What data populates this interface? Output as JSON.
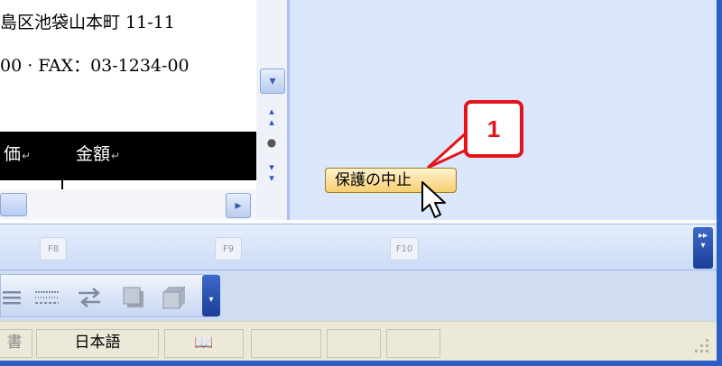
{
  "document": {
    "address_line": "島区池袋山本町 11-11",
    "phone_line": "00 · FAX：03-1234-00",
    "table_header": {
      "col1": "価",
      "col2": "金額",
      "para_mark": "↵"
    }
  },
  "scrollbar": {
    "down_glyph": "▾",
    "prev_glyph": "▴\n▴",
    "select_glyph": "●",
    "next_glyph": "▾\n▾",
    "right_glyph": "▸"
  },
  "task_pane": {
    "stop_protection_label": "保護の中止",
    "callout_number": "1"
  },
  "function_keys": {
    "f8": "F8",
    "f9": "F9",
    "f10": "F10",
    "overflow": "▸▸\n▾"
  },
  "toolbar": {
    "icons": [
      "align-justify-icon",
      "dotted-lines-icon",
      "swap-arrows-icon",
      "shadow-square-icon",
      "3d-cube-icon"
    ],
    "overflow": "▾"
  },
  "statusbar": {
    "doc_fragment": "書",
    "language": "日本語",
    "book_icon_label": "📖"
  },
  "colors": {
    "accent_red": "#e4141a",
    "xp_blue": "#2b5fc6",
    "button_gold": "#f7cf70"
  }
}
